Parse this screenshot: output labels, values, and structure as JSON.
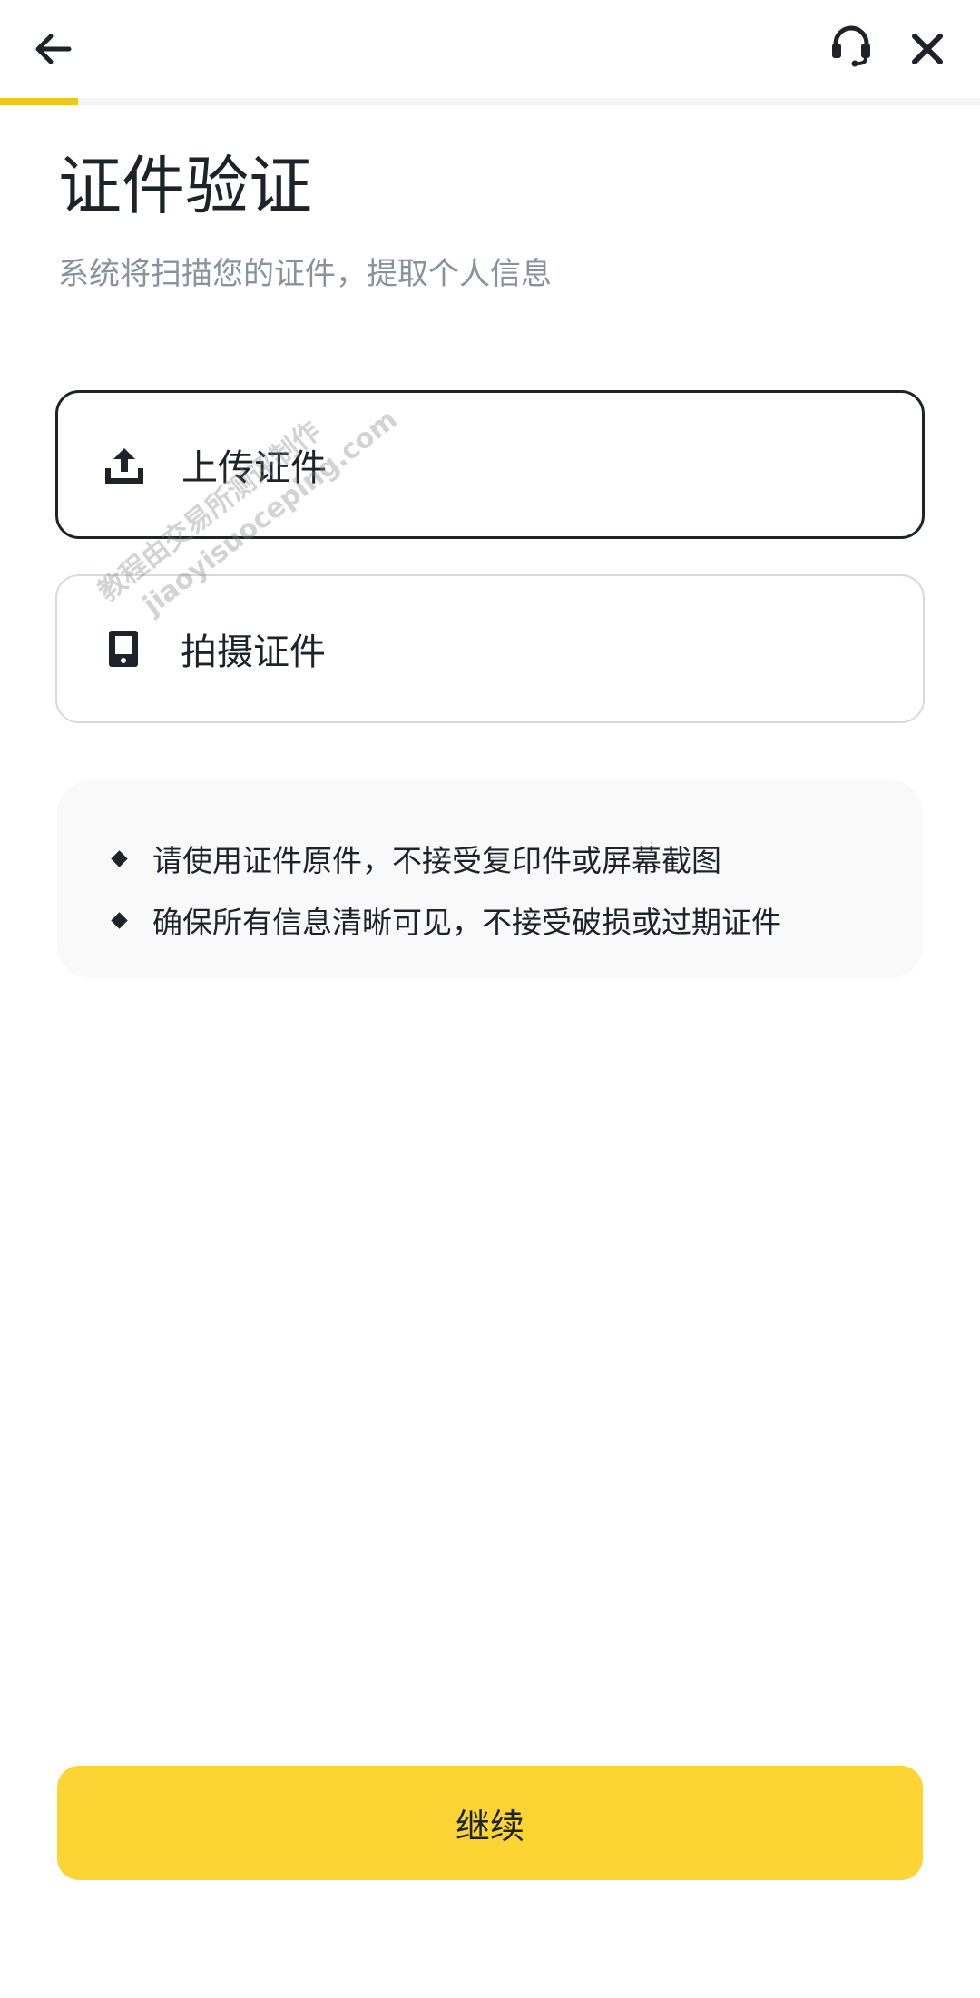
{
  "header": {
    "back_icon": "arrow-left-icon",
    "support_icon": "headset-icon",
    "close_icon": "close-icon",
    "progress_fraction": 0.08,
    "progress_color": "#f0c61c"
  },
  "main": {
    "title": "证件验证",
    "subtitle": "系统将扫描您的证件，提取个人信息",
    "options": [
      {
        "label": "上传证件",
        "icon": "upload-icon",
        "selected": true
      },
      {
        "label": "拍摄证件",
        "icon": "camera-phone-icon",
        "selected": false
      }
    ],
    "tips": [
      "请使用证件原件，不接受复印件或屏幕截图",
      "确保所有信息清晰可见，不接受破损或过期证件"
    ]
  },
  "watermark": {
    "line1": "教程由交易所测评制作",
    "line2": "jiaoyisuoceping.com"
  },
  "footer": {
    "continue_label": "继续",
    "button_color": "#fcd535"
  }
}
